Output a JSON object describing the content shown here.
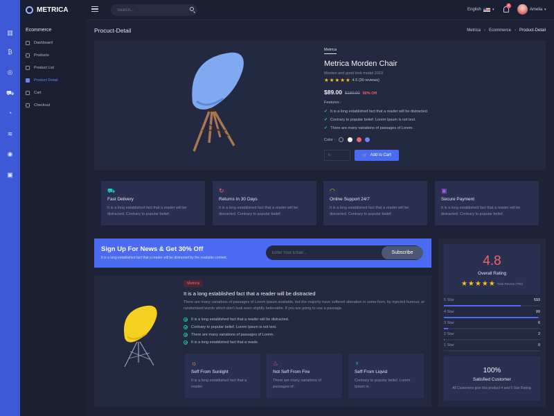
{
  "app": {
    "name": "METRICA"
  },
  "search": {
    "placeholder": "Search..."
  },
  "header": {
    "language": "English",
    "notifications": "2",
    "user": "Amelia"
  },
  "sidebar": {
    "title": "Ecommerce",
    "items": [
      {
        "label": "Dashboard"
      },
      {
        "label": "Products"
      },
      {
        "label": "Product List"
      },
      {
        "label": "Product Detail"
      },
      {
        "label": "Cart"
      },
      {
        "label": "Checkout"
      }
    ]
  },
  "page": {
    "title": "Procuct-Detail",
    "breadcrumb": [
      "Metrica",
      "Ecommerce",
      "Product-Detail"
    ]
  },
  "product": {
    "brand": "Metrica",
    "name": "Metrica Morden Chair",
    "subtitle": "Morden and good look model 2019",
    "rating_text": "4.5 (30 reviews)",
    "price": "$89.00",
    "old_price": "$180.00",
    "discount": "50% Off",
    "features_label": "Features :",
    "features": [
      "It is a long established fact that a reader will be distracted.",
      "Contrary to popular belief. Lorem Ipsum is not text.",
      "There are many variations of passages of Lorem."
    ],
    "color_label": "Color :",
    "colors": [
      "#232940",
      "#ffffff",
      "#f1646c",
      "#6d85f5"
    ],
    "qty_placeholder": "0",
    "add_to_cart": "Add to Cart"
  },
  "info_cards": [
    {
      "title": "Fast Delivery",
      "text": "It is a long established fact that a reader will be distracted. Contrary to popular belief.",
      "icon": "truck-icon",
      "color": "#1ecab8"
    },
    {
      "title": "Returns In 30 Days",
      "text": "It is a long established fact that a reader will be distracted. Contrary to popular belief.",
      "icon": "return-icon",
      "color": "#f1646c"
    },
    {
      "title": "Online Support 24/7",
      "text": "It is a long established fact that a reader will be distracted. Contrary to popular belief.",
      "icon": "headset-icon",
      "color": "#ffc01e"
    },
    {
      "title": "Secure Payment",
      "text": "It is a long established fact that a reader will be distracted. Contrary to popular belief.",
      "icon": "wallet-icon",
      "color": "#a45ce6"
    }
  ],
  "newsletter": {
    "title": "Sign Up For News & Get 30% Off",
    "text": "It is a long established fact that a reader will be distracted by the readable content.",
    "placeholder": "Enter Your Email...",
    "button": "Subscribe"
  },
  "detail": {
    "badge": "Metrica",
    "title": "It is a long established fact that a reader will be distracted",
    "paragraph": "There are many variations of passages of Lorem Ipsum available, but the majority have suffered alteration in some form, by injected humour, or randomised words which don't look even slightly believable. If you are going to use a passage.",
    "features": [
      "It is a long established fact that a reader will be distracted.",
      "Contrary to popular belief. Lorem Ipsum is not text.",
      "There are many variations of passages of Lorem.",
      "It is a long established fact that a reade."
    ],
    "mini_cards": [
      {
        "title": "Seff From Sunlight",
        "text": "It is a long established fact that a reader.",
        "icon": "sun-icon",
        "color": "#ffc01e"
      },
      {
        "title": "Not Seff From Fire",
        "text": "There are many variations of passages of.",
        "icon": "fire-icon",
        "color": "#f1646c"
      },
      {
        "title": "Seff From Liqvid",
        "text": "Contrary to popular belief. Lorem Ipsum is .",
        "icon": "drop-icon",
        "color": "#1ecab8"
      }
    ]
  },
  "rating": {
    "score": "4.8",
    "label": "Overall Rating",
    "total": "Total Review (700)",
    "rows": [
      {
        "label": "5 Star",
        "count": "593",
        "fraction": 0.8
      },
      {
        "label": "4 Star",
        "count": "99",
        "fraction": 0.98
      },
      {
        "label": "3 Star",
        "count": "6",
        "fraction": 0.04
      },
      {
        "label": "2 Star",
        "count": "2",
        "fraction": 0.01
      },
      {
        "label": "1 Star",
        "count": "0",
        "fraction": 0
      }
    ],
    "satisfied_pct": "100%",
    "satisfied_title": "Satisfied Customer",
    "satisfied_text": "All Customers give this product 4 and 5 Star Rating."
  }
}
